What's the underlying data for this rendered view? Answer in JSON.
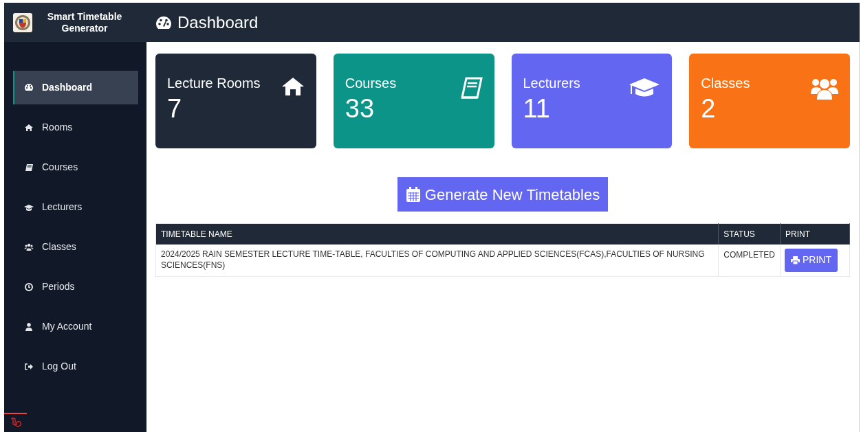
{
  "app": {
    "title": "Smart Timetable Generator"
  },
  "header": {
    "title": "Dashboard"
  },
  "sidebar": {
    "items": [
      {
        "label": "Dashboard",
        "selected": true
      },
      {
        "label": "Rooms",
        "selected": false
      },
      {
        "label": "Courses",
        "selected": false
      },
      {
        "label": "Lecturers",
        "selected": false
      },
      {
        "label": "Classes",
        "selected": false
      },
      {
        "label": "Periods",
        "selected": false
      },
      {
        "label": "My Account",
        "selected": false
      },
      {
        "label": "Log Out",
        "selected": false
      }
    ]
  },
  "cards": [
    {
      "label": "Lecture Rooms",
      "value": "7",
      "color": "#1f2937"
    },
    {
      "label": "Courses",
      "value": "33",
      "color": "#0d9488"
    },
    {
      "label": "Lecturers",
      "value": "11",
      "color": "#6366f1"
    },
    {
      "label": "Classes",
      "value": "2",
      "color": "#f97316"
    }
  ],
  "generate_button": {
    "label": "Generate New Timetables"
  },
  "table": {
    "columns": [
      "TIMETABLE NAME",
      "STATUS",
      "PRINT"
    ],
    "rows": [
      {
        "name": "2024/2025 RAIN SEMESTER LECTURE TIME-TABLE, FACULTIES OF COMPUTING AND APPLIED SCIENCES(FCAS),FACULTIES OF NURSING SCIENCES(FNS)",
        "status": "COMPLETED",
        "action": "PRINT"
      }
    ]
  }
}
